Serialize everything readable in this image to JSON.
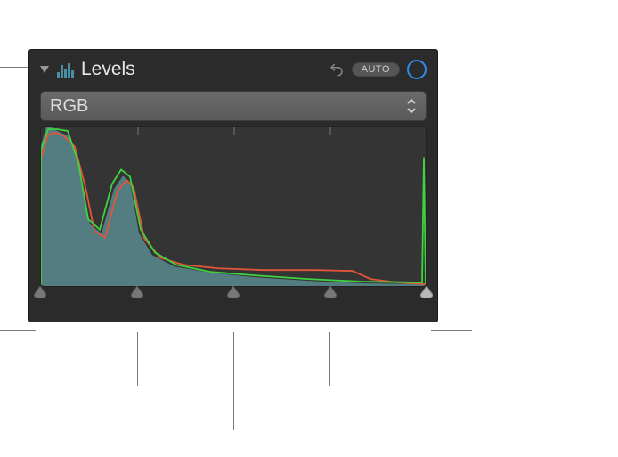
{
  "header": {
    "title": "Levels",
    "auto_label": "AUTO"
  },
  "dropdown": {
    "selected": "RGB"
  },
  "sliders": {
    "black_point": 0,
    "shadows": 25,
    "midtones": 50,
    "highlights": 75,
    "white_point": 100
  }
}
